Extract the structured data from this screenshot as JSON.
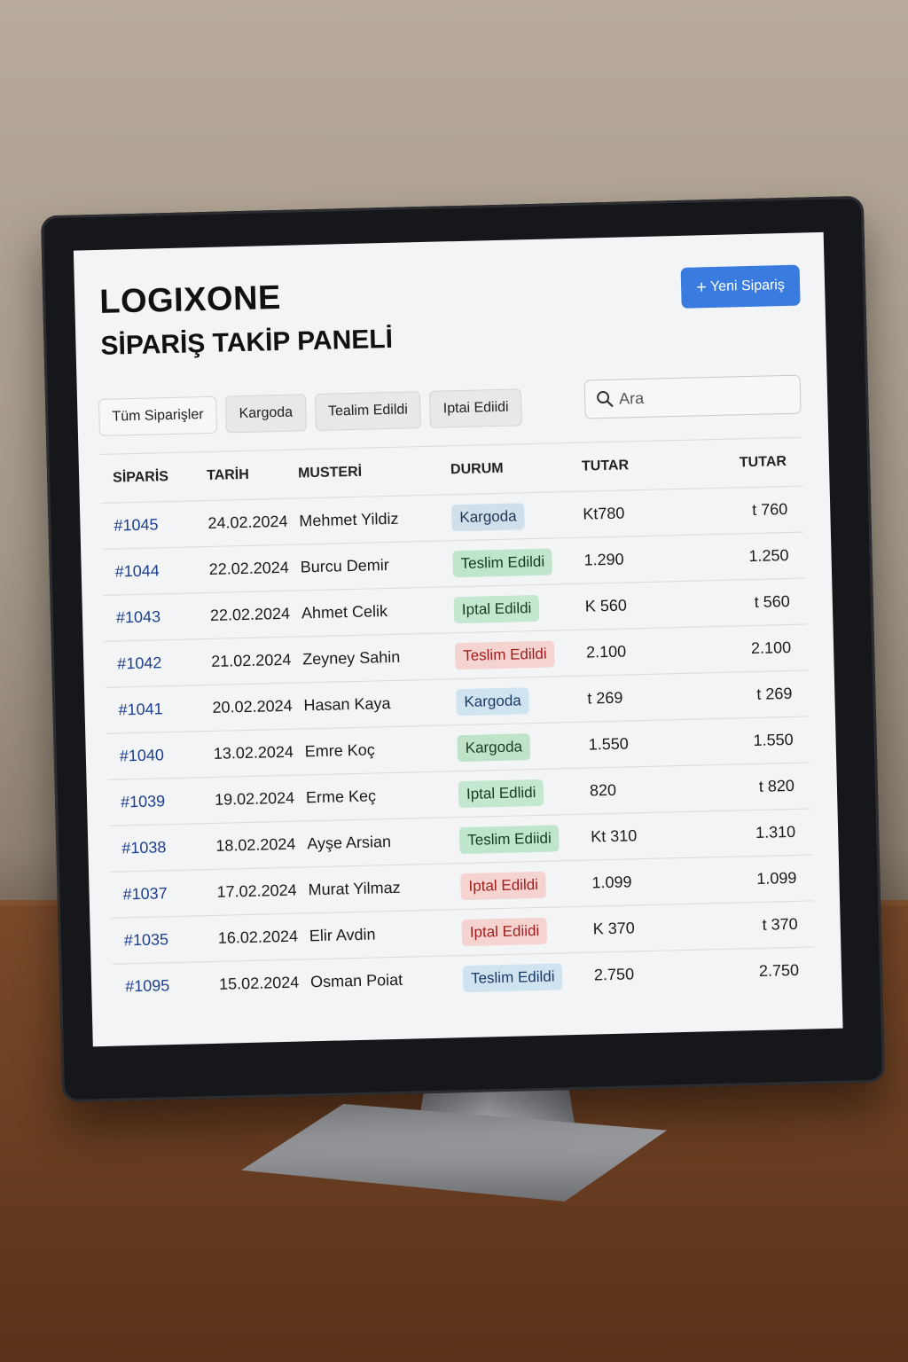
{
  "header": {
    "brand": "LOGIXONE",
    "subtitle": "SİPARİŞ TAKİP PANELİ",
    "new_order_label": "Yeni Sipariş",
    "new_order_icon": "plus-icon"
  },
  "filters": [
    {
      "label": "Tüm Siparişler",
      "active": true
    },
    {
      "label": "Kargoda",
      "active": false
    },
    {
      "label": "Tealim Edildi",
      "active": false
    },
    {
      "label": "Iptai Ediidi",
      "active": false
    }
  ],
  "search": {
    "placeholder": "Ara",
    "icon": "search-icon"
  },
  "table": {
    "columns": [
      "SİPARİS",
      "TARİH",
      "MUSTERİ",
      "DURUM",
      "TUTAR",
      "TUTAR"
    ],
    "rows": [
      {
        "id": "#1045",
        "date": "24.02.2024",
        "customer": "Mehmet Yildiz",
        "status": "Kargoda",
        "status_style": "b-kargo",
        "amount1": "Kt780",
        "amount2": "t 760"
      },
      {
        "id": "#1044",
        "date": "22.02.2024",
        "customer": "Burcu Demir",
        "status": "Teslim Edildi",
        "status_style": "b-teslim",
        "amount1": "1.290",
        "amount2": "1.250"
      },
      {
        "id": "#1043",
        "date": "22.02.2024",
        "customer": "Ahmet Celik",
        "status": "Iptal Edildi",
        "status_style": "b-iptal",
        "amount1": "K 560",
        "amount2": "t 560"
      },
      {
        "id": "#1042",
        "date": "21.02.2024",
        "customer": "Zeyney Sahin",
        "status": "Teslim Edildi",
        "status_style": "b-red",
        "amount1": "2.100",
        "amount2": "2.100"
      },
      {
        "id": "#1041",
        "date": "20.02.2024",
        "customer": "Hasan Kaya",
        "status": "Kargoda",
        "status_style": "b-blue",
        "amount1": "t 269",
        "amount2": "t 269"
      },
      {
        "id": "#1040",
        "date": "13.02.2024",
        "customer": "Emre Koç",
        "status": "Kargoda",
        "status_style": "b-kargo-green",
        "amount1": "1.550",
        "amount2": "1.550"
      },
      {
        "id": "#1039",
        "date": "19.02.2024",
        "customer": "Erme Keç",
        "status": "Iptal Edlidi",
        "status_style": "b-iptal",
        "amount1": "820",
        "amount2": "t 820"
      },
      {
        "id": "#1038",
        "date": "18.02.2024",
        "customer": "Ayşe Arsian",
        "status": "Teslim Ediidi",
        "status_style": "b-teslim",
        "amount1": "Kt 310",
        "amount2": "1.310"
      },
      {
        "id": "#1037",
        "date": "17.02.2024",
        "customer": "Murat Yilmaz",
        "status": "Iptal Edildi",
        "status_style": "b-red",
        "amount1": "1.099",
        "amount2": "1.099"
      },
      {
        "id": "#1035",
        "date": "16.02.2024",
        "customer": "Elir Avdin",
        "status": "Iptal Ediidi",
        "status_style": "b-red",
        "amount1": "K 370",
        "amount2": "t 370"
      },
      {
        "id": "#1095",
        "date": "15.02.2024",
        "customer": "Osman Poiat",
        "status": "Teslim Edildi",
        "status_style": "b-blue",
        "amount1": "2.750",
        "amount2": "2.750"
      }
    ]
  }
}
